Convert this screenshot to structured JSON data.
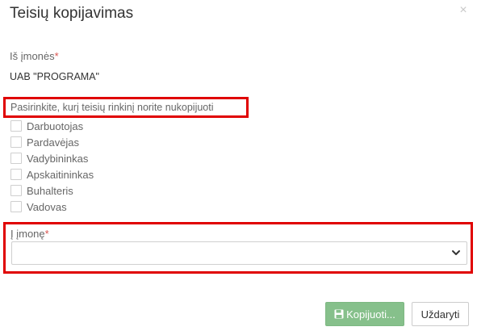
{
  "dialog": {
    "title": "Teisių kopijavimas",
    "close_glyph": "×"
  },
  "from_company": {
    "label": "Iš įmonės",
    "required_mark": "*",
    "value": "UAB \"PROGRAMA\""
  },
  "rights_set": {
    "prompt": "Pasirinkite, kurį teisių rinkinį norite nukopijuoti",
    "options": [
      {
        "label": "Darbuotojas",
        "checked": false
      },
      {
        "label": "Pardavėjas",
        "checked": false
      },
      {
        "label": "Vadybininkas",
        "checked": false
      },
      {
        "label": "Apskaitininkas",
        "checked": false
      },
      {
        "label": "Buhalteris",
        "checked": false
      },
      {
        "label": "Vadovas",
        "checked": false
      }
    ]
  },
  "to_company": {
    "label": "Į įmonę",
    "required_mark": "*",
    "selected_value": "",
    "icon": "chevron-down-icon"
  },
  "buttons": {
    "copy_label": "Kopijuoti...",
    "copy_icon": "save-icon",
    "close_label": "Uždaryti"
  },
  "colors": {
    "highlight": "#e00000",
    "required": "#d9534f",
    "primary_button": "#86c08b"
  }
}
